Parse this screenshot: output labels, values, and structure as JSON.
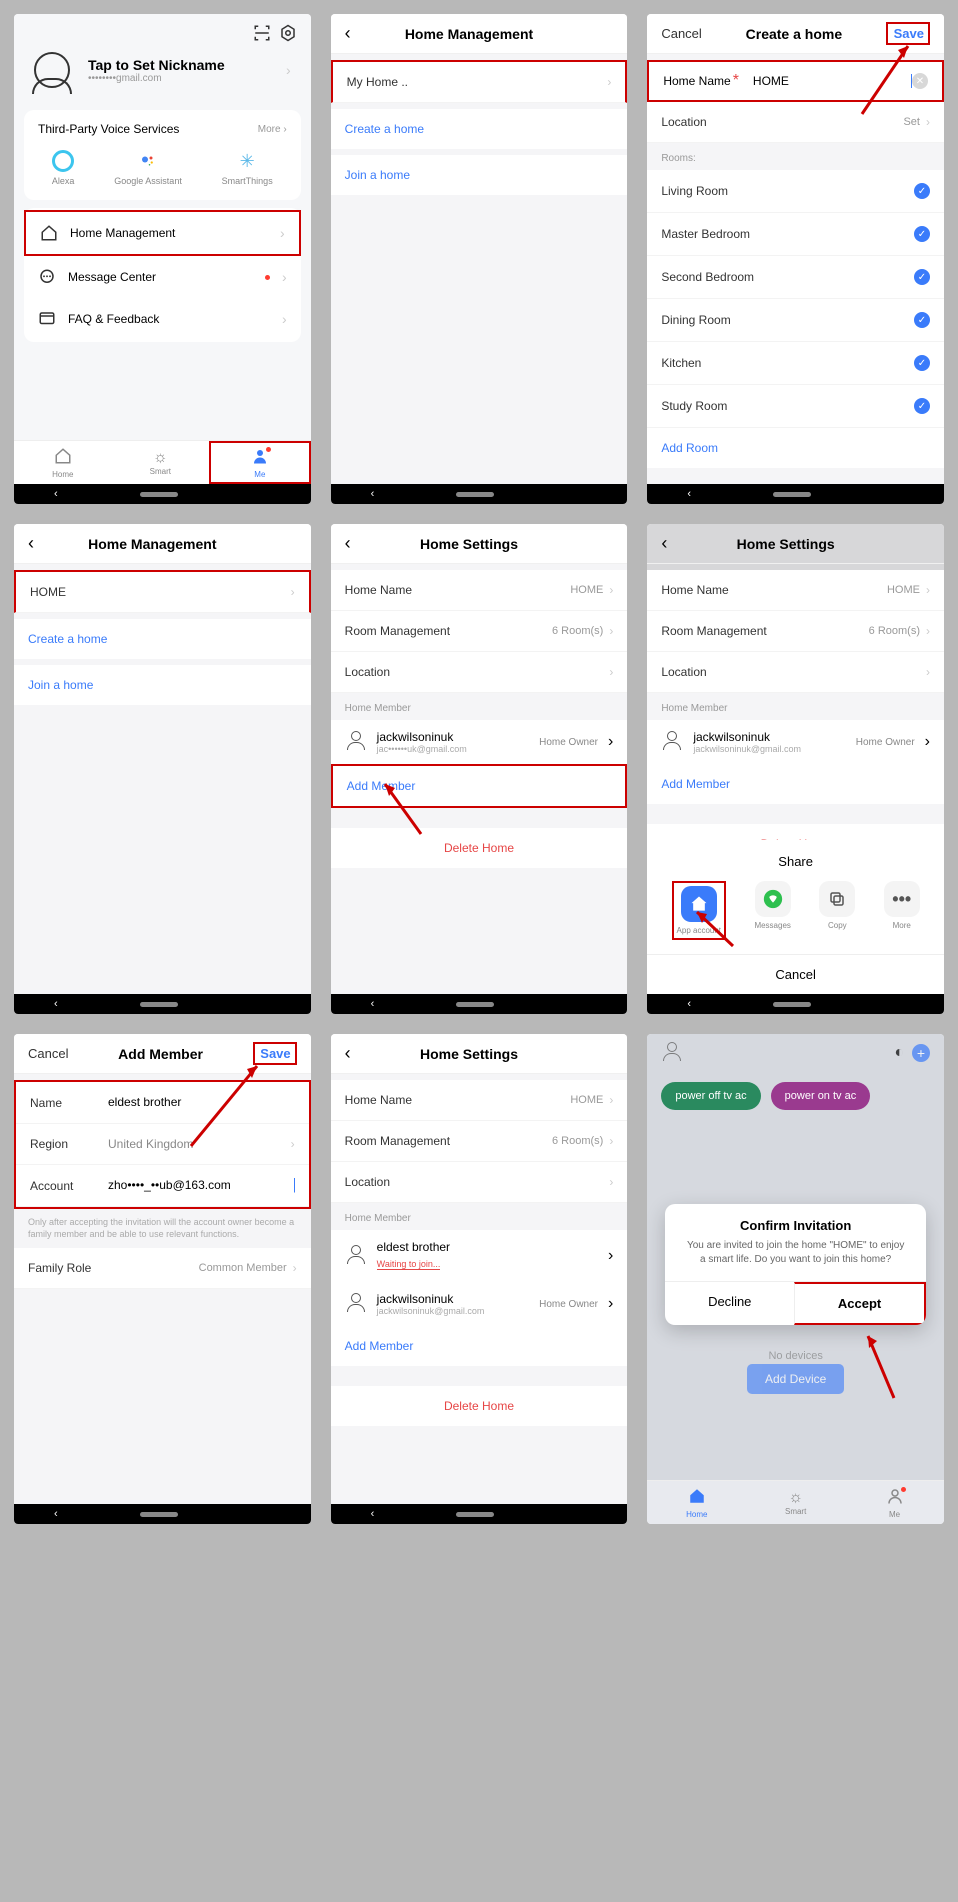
{
  "s1": {
    "nickname": "Tap to Set Nickname",
    "email": "••••••••gmail.com",
    "voiceTitle": "Third-Party Voice Services",
    "more": "More",
    "voices": [
      "Alexa",
      "Google Assistant",
      "SmartThings"
    ],
    "menu": {
      "home": "Home Management",
      "msg": "Message Center",
      "faq": "FAQ & Feedback"
    },
    "nav": {
      "home": "Home",
      "smart": "Smart",
      "me": "Me"
    }
  },
  "s2": {
    "title": "Home Management",
    "myhome": "My Home ..",
    "create": "Create a home",
    "join": "Join a home"
  },
  "s3": {
    "cancel": "Cancel",
    "title": "Create a home",
    "save": "Save",
    "hnLabel": "Home Name",
    "hnVal": "HOME",
    "loc": "Location",
    "locVal": "Set",
    "roomsHdr": "Rooms:",
    "rooms": [
      "Living Room",
      "Master Bedroom",
      "Second Bedroom",
      "Dining Room",
      "Kitchen",
      "Study Room"
    ],
    "add": "Add Room"
  },
  "s4": {
    "title": "Home Management",
    "home": "HOME",
    "create": "Create a home",
    "join": "Join a home"
  },
  "s5": {
    "title": "Home Settings",
    "hn": "Home Name",
    "hnVal": "HOME",
    "rm": "Room Management",
    "rmVal": "6 Room(s)",
    "loc": "Location",
    "memHdr": "Home Member",
    "memName": "jackwilsoninuk",
    "memEmail": "jac••••••uk@gmail.com",
    "memRole": "Home Owner",
    "addMem": "Add Member",
    "del": "Delete Home"
  },
  "s6": {
    "share": "Share",
    "opts": {
      "app": "App account",
      "msg": "Messages",
      "copy": "Copy",
      "more": "More"
    },
    "cancel": "Cancel",
    "memEmail": "jackwilsoninuk@gmail.com"
  },
  "s7": {
    "cancel": "Cancel",
    "title": "Add Member",
    "save": "Save",
    "name": "Name",
    "nameVal": "eldest brother",
    "region": "Region",
    "regionVal": "United Kingdom",
    "account": "Account",
    "accountVal": "zho••••_••ub@163.com",
    "note": "Only after accepting the invitation will the account owner become a family member and be able to use relevant functions.",
    "role": "Family Role",
    "roleVal": "Common Member"
  },
  "s8": {
    "mem1Name": "eldest brother",
    "mem1Status": "Waiting to join...",
    "mem2Name": "jackwilsoninuk",
    "mem2Email": "jackwilsoninuk@gmail.com",
    "mem2Role": "Home Owner"
  },
  "s9": {
    "pill1": "power off tv ac",
    "pill2": "power on tv ac",
    "dlgTitle": "Confirm Invitation",
    "dlgBody": "You are invited to join the home \"HOME\" to enjoy a smart life. Do you want to join this home?",
    "decline": "Decline",
    "accept": "Accept",
    "nodev": "No devices",
    "addDev": "Add Device"
  }
}
